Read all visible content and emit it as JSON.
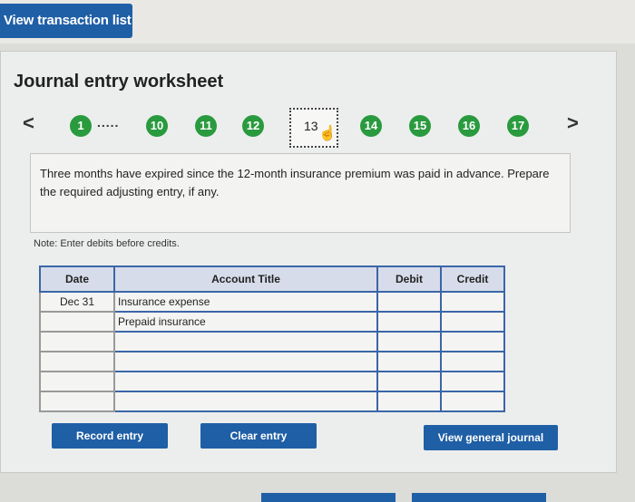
{
  "view_transaction_list": "View transaction list",
  "worksheet_title": "Journal entry worksheet",
  "nav": {
    "prev": "<",
    "next": ">",
    "first": "1",
    "ellipsis": ".....",
    "steps": [
      "10",
      "11",
      "12"
    ],
    "current": "13",
    "steps_after": [
      "14",
      "15",
      "16",
      "17"
    ]
  },
  "instruction": "Three months have expired since the 12-month insurance premium was paid in advance. Prepare the required adjusting entry, if any.",
  "note": "Note: Enter debits before credits.",
  "table": {
    "headers": {
      "date": "Date",
      "account": "Account Title",
      "debit": "Debit",
      "credit": "Credit"
    },
    "rows": [
      {
        "date": "Dec 31",
        "account": "Insurance expense",
        "debit": "",
        "credit": ""
      },
      {
        "date": "",
        "account": "Prepaid insurance",
        "debit": "",
        "credit": ""
      },
      {
        "date": "",
        "account": "",
        "debit": "",
        "credit": ""
      },
      {
        "date": "",
        "account": "",
        "debit": "",
        "credit": ""
      },
      {
        "date": "",
        "account": "",
        "debit": "",
        "credit": ""
      },
      {
        "date": "",
        "account": "",
        "debit": "",
        "credit": ""
      }
    ]
  },
  "buttons": {
    "record": "Record entry",
    "clear": "Clear entry",
    "view_general_journal": "View general journal"
  },
  "colors": {
    "accent": "#1f5fa6",
    "step_green": "#2a9a3e"
  }
}
